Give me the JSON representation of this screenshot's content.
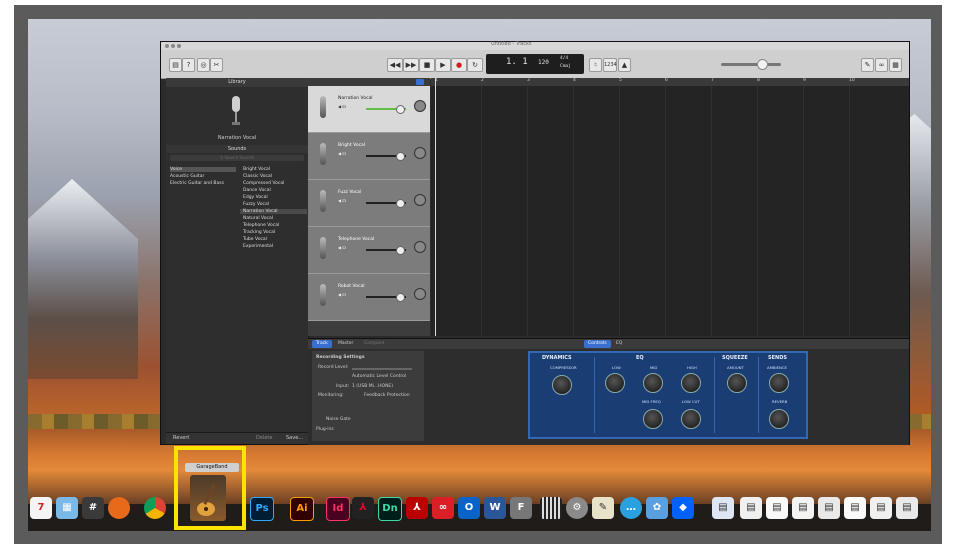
{
  "window": {
    "title": "Untitled - Tracks"
  },
  "transport": {
    "position": "1. 1",
    "tempo": "120",
    "signature": "4/4",
    "key": "Cmaj",
    "zoom": "100",
    "count_in": "1234"
  },
  "library": {
    "header": "Library",
    "selected_preset": "Narration Vocal",
    "sounds_label": "Sounds",
    "search_placeholder": "Q  Search Sounds",
    "categories": [
      "Voice",
      "Acoustic Guitar",
      "Electric Guitar and Bass"
    ],
    "presets": [
      "Bright Vocal",
      "Classic Vocal",
      "Compressed Vocal",
      "Dance Vocal",
      "Edgy Vocal",
      "Fuzzy Vocal",
      "Narration Vocal",
      "Natural Vocal",
      "Telephone Vocal",
      "Tracking Vocal",
      "Tube Vocal",
      "Experimental"
    ],
    "revert": "Revert",
    "delete": "Delete",
    "save": "Save..."
  },
  "tracks": [
    {
      "name": "Narration Vocal"
    },
    {
      "name": "Bright Vocal"
    },
    {
      "name": "Fuzz Vocal"
    },
    {
      "name": "Telephone Vocal"
    },
    {
      "name": "Robot Vocal"
    }
  ],
  "ruler": [
    "1",
    "2",
    "3",
    "4",
    "5",
    "6",
    "7",
    "8",
    "9",
    "10"
  ],
  "smart_controls": {
    "tabs": [
      "Track",
      "Master",
      "Compare"
    ],
    "right_tabs": [
      "Controls",
      "EQ"
    ],
    "recording_settings": "Recording Settings",
    "record_level": "Record Level:",
    "auto_level": "Automatic Level Control",
    "input_label": "Input:",
    "input_value": "1 (USB Mi...HONE)",
    "monitoring_label": "Monitoring:",
    "feedback": "Feedback Protection",
    "noise_gate": "Noise Gate",
    "plug_ins": "Plug-ins",
    "sections": [
      "DYNAMICS",
      "EQ",
      "SQUEEZE",
      "SENDS"
    ],
    "knobs": [
      "COMPRESSOR",
      "LOW",
      "MID",
      "HIGH",
      "MID FREQ",
      "LOW CUT",
      "AMOUNT",
      "AMBIENCE",
      "REVERB"
    ]
  },
  "dock": {
    "tooltip": "GarageBand",
    "calendar_day": "7",
    "apps": [
      "Ps",
      "Ai",
      "Id",
      "Dn",
      "W"
    ]
  }
}
